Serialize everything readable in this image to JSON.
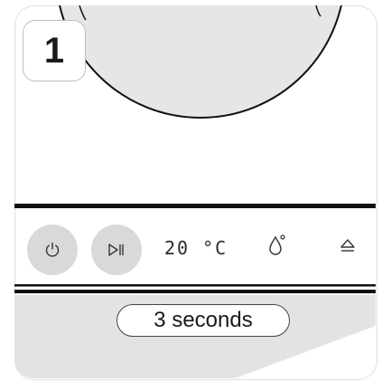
{
  "step": {
    "number": "1"
  },
  "panel": {
    "power_icon": "power-icon",
    "play_pause_icon": "play-pause-icon",
    "temperature": "20 °C",
    "drop_icon": "water-drop-icon",
    "eject_icon": "eject-icon"
  },
  "hint": {
    "duration": "3 seconds"
  },
  "colors": {
    "button_fill": "#d9d9d9",
    "wedge_fill": "#e3e3e3",
    "line": "#111111"
  }
}
